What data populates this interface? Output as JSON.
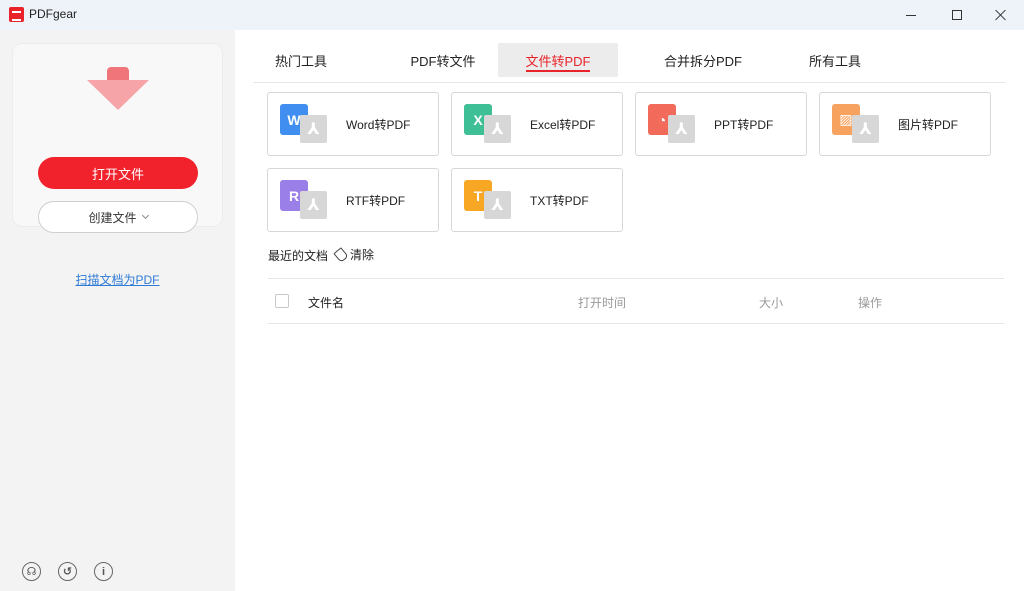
{
  "window": {
    "title": "PDFgear"
  },
  "sidebar": {
    "open_file": "打开文件",
    "create_file": "创建文件",
    "scan_link": "扫描文档为PDF"
  },
  "tabs": [
    {
      "label": "热门工具"
    },
    {
      "label": "PDF转文件"
    },
    {
      "label": "文件转PDF",
      "active": true
    },
    {
      "label": "合并拆分PDF"
    },
    {
      "label": "所有工具"
    }
  ],
  "tools": [
    {
      "label": "Word转PDF",
      "glyph": "W",
      "color": "#3f8ef0"
    },
    {
      "label": "Excel转PDF",
      "glyph": "X",
      "color": "#3fbf95"
    },
    {
      "label": "PPT转PDF",
      "glyph": "◔",
      "color": "#f26a5a"
    },
    {
      "label": "图片转PDF",
      "glyph": "▨",
      "color": "#f7a25e"
    },
    {
      "label": "RTF转PDF",
      "glyph": "R",
      "color": "#9b7fe8"
    },
    {
      "label": "TXT转PDF",
      "glyph": "T",
      "color": "#f7a723"
    }
  ],
  "recent": {
    "label": "最近的文档",
    "clear": "清除",
    "columns": {
      "name": "文件名",
      "time": "打开时间",
      "size": "大小",
      "ops": "操作"
    }
  },
  "colors": {
    "accent": "#e8232a",
    "link": "#2e7bd6"
  }
}
